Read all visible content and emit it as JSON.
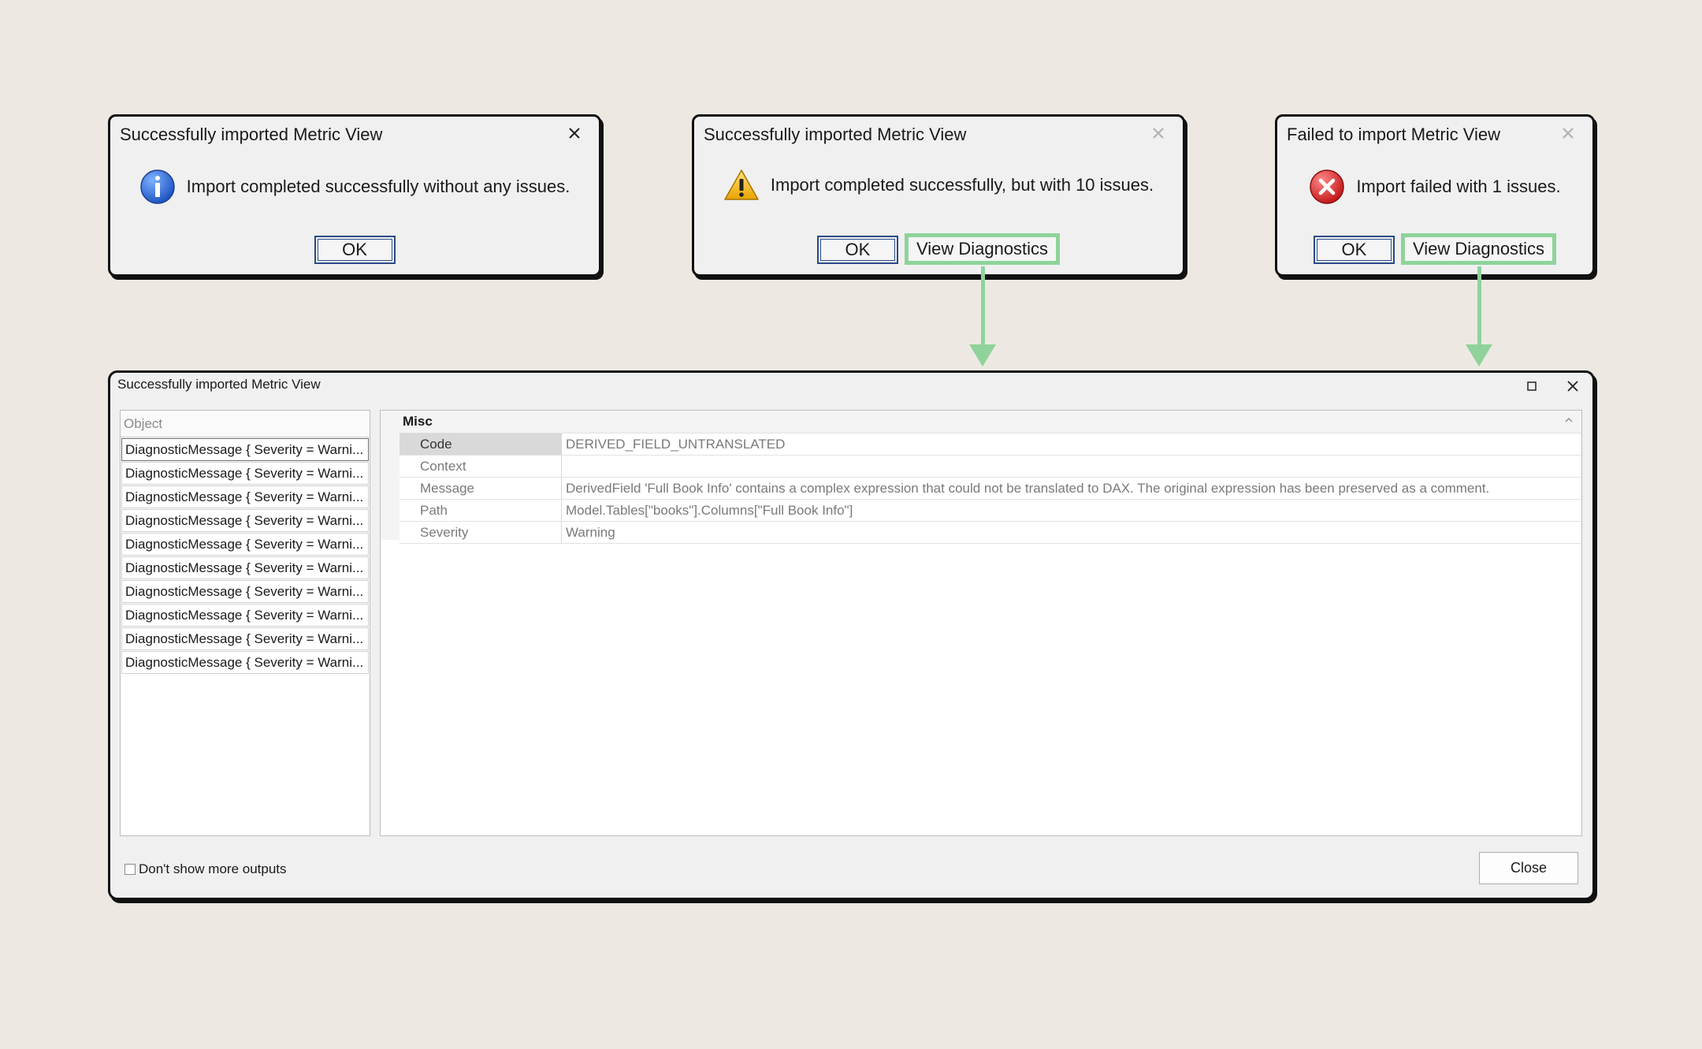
{
  "dialog_success": {
    "title": "Successfully imported Metric View",
    "message": "Import completed successfully without any issues.",
    "icon": "info-icon",
    "ok_label": "OK"
  },
  "dialog_warning": {
    "title": "Successfully imported Metric View",
    "message": "Import completed successfully, but with 10 issues.",
    "icon": "warning-icon",
    "ok_label": "OK",
    "diagnostics_label": "View Diagnostics"
  },
  "dialog_error": {
    "title": "Failed to import Metric View",
    "message": "Import failed with 1 issues.",
    "icon": "error-icon",
    "ok_label": "OK",
    "diagnostics_label": "View Diagnostics"
  },
  "diagnostics_window": {
    "title": "Successfully imported Metric View",
    "object_header": "Object",
    "objects": [
      "DiagnosticMessage { Severity = Warni...",
      "DiagnosticMessage { Severity = Warni...",
      "DiagnosticMessage { Severity = Warni...",
      "DiagnosticMessage { Severity = Warni...",
      "DiagnosticMessage { Severity = Warni...",
      "DiagnosticMessage { Severity = Warni...",
      "DiagnosticMessage { Severity = Warni...",
      "DiagnosticMessage { Severity = Warni...",
      "DiagnosticMessage { Severity = Warni...",
      "DiagnosticMessage { Severity = Warni..."
    ],
    "category": "Misc",
    "properties": [
      {
        "name": "Code",
        "value": "DERIVED_FIELD_UNTRANSLATED"
      },
      {
        "name": "Context",
        "value": ""
      },
      {
        "name": "Message",
        "value": "DerivedField 'Full Book Info' contains a complex expression that could not be translated to DAX. The original expression has been preserved as a comment."
      },
      {
        "name": "Path",
        "value": "Model.Tables[\"books\"].Columns[\"Full Book Info\"]"
      },
      {
        "name": "Severity",
        "value": "Warning"
      }
    ],
    "dont_show_label": "Don't show more outputs",
    "close_label": "Close"
  },
  "colors": {
    "background": "#ede9e2",
    "highlight_green": "#8fd39a",
    "ok_border": "#2b4a86"
  }
}
